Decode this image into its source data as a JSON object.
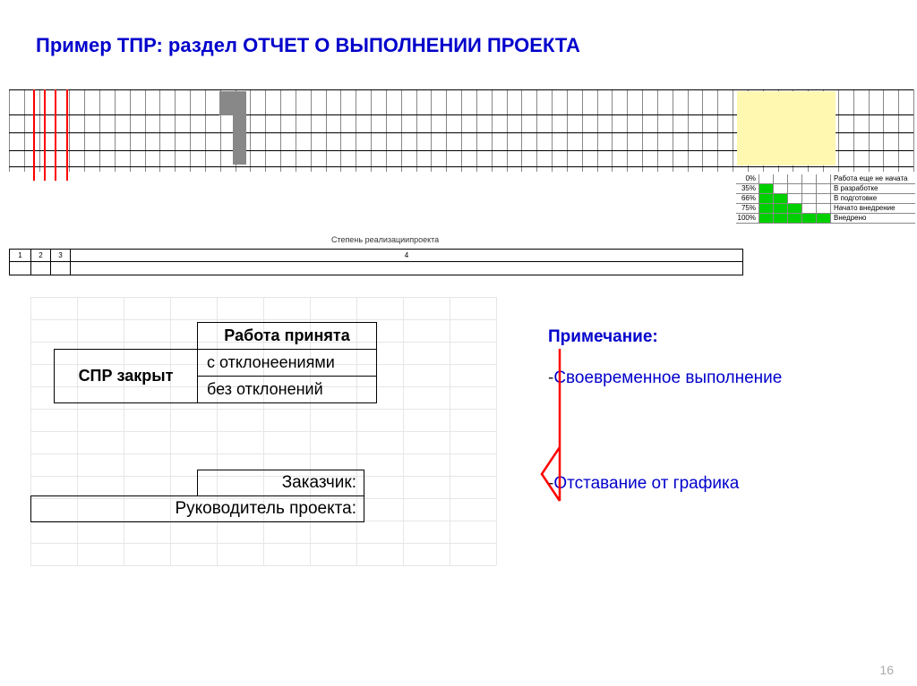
{
  "title": "Пример ТПР: раздел ОТЧЕТ О ВЫПОЛНЕНИИ ПРОЕКТА",
  "legend": [
    {
      "pct": "0%",
      "green": 0,
      "text": "Работа еще не начата"
    },
    {
      "pct": "35%",
      "green": 1,
      "text": "В разработке"
    },
    {
      "pct": "66%",
      "green": 2,
      "text": "В подготовке"
    },
    {
      "pct": "75%",
      "green": 3,
      "text": "Начато внедрение"
    },
    {
      "pct": "100%",
      "green": 5,
      "text": "Внедрено"
    }
  ],
  "stepen_label": "Степень реализациипроекта",
  "step_cols": [
    "1",
    "2",
    "3",
    "4"
  ],
  "accept": {
    "header": "Работа принята",
    "left": "СПР закрыт",
    "r1": "с отклонеениями",
    "r2": "без отклонений"
  },
  "sig": {
    "customer": "Заказчик:",
    "pm": "Руководитель проекта:"
  },
  "note": {
    "head": "Примечание:",
    "l1_prefix": "-",
    "l1": "Своевременное выполнение",
    "l2_prefix": "-",
    "l2": "Отставание от графика"
  },
  "page": "16"
}
